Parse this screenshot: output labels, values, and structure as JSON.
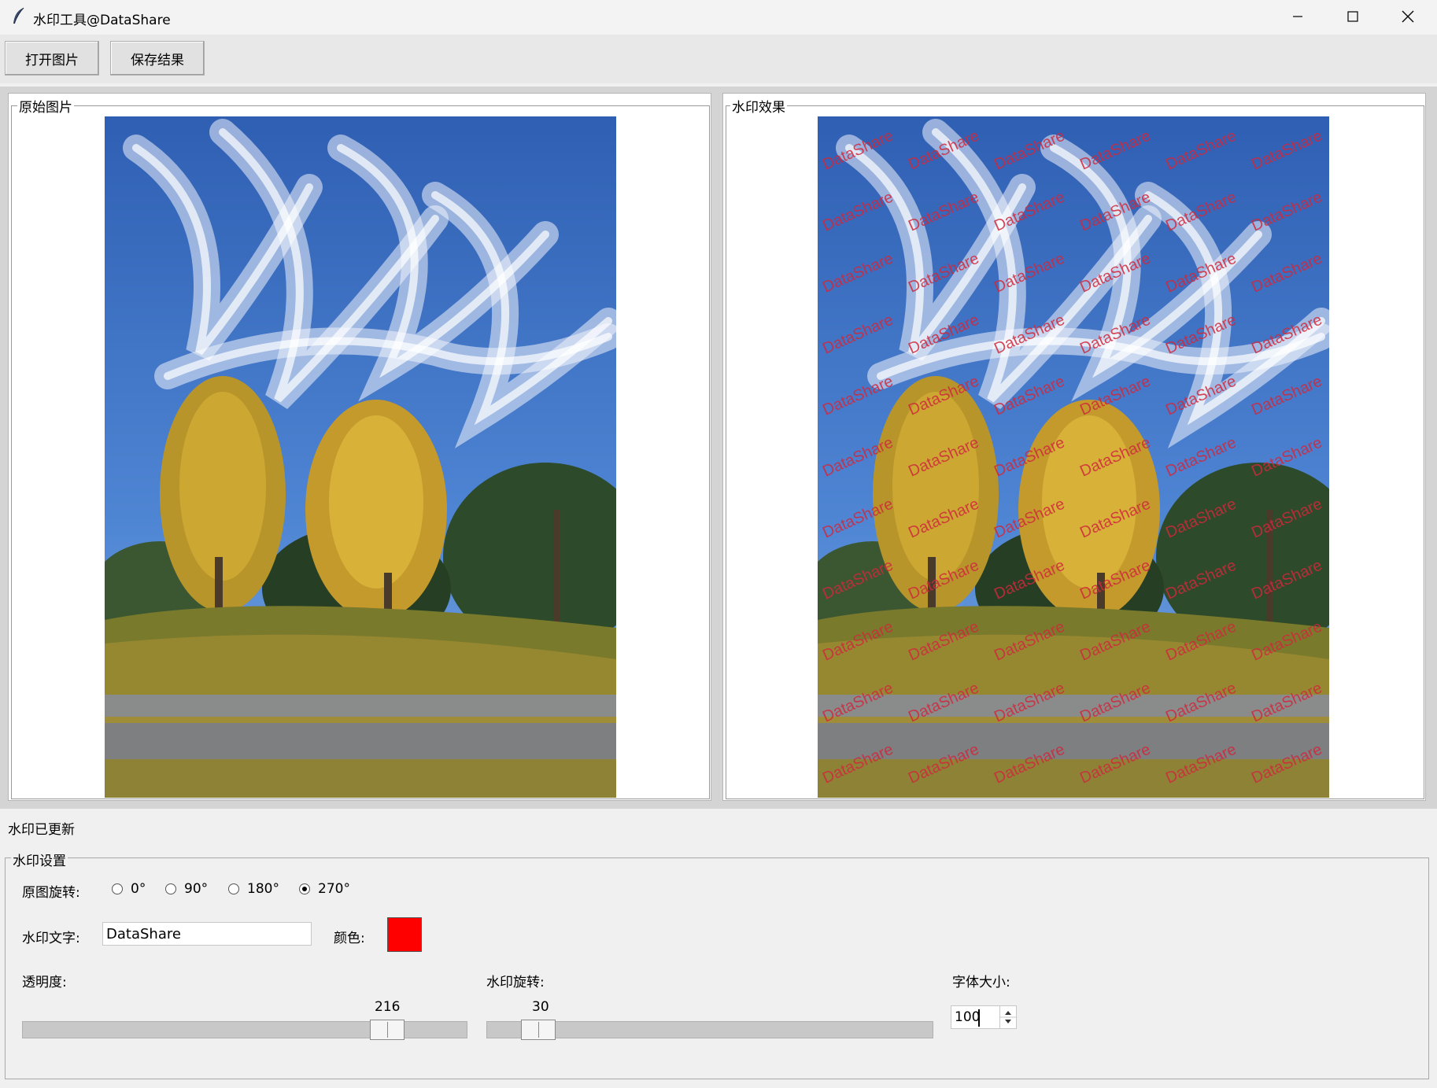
{
  "window": {
    "title": "水印工具@DataShare"
  },
  "toolbar": {
    "open_label": "打开图片",
    "save_label": "保存结果"
  },
  "panels": {
    "original_label": "原始图片",
    "result_label": "水印效果",
    "watermark_overlay_text": "DataShare",
    "watermark_overlay_color": "#d0283c"
  },
  "status": {
    "text": "水印已更新"
  },
  "settings": {
    "group_label": "水印设置",
    "rotation_label": "原图旋转:",
    "rotation_options": [
      "0°",
      "90°",
      "180°",
      "270°"
    ],
    "rotation_selected": "270°",
    "text_label": "水印文字:",
    "text_value": "DataShare",
    "color_label": "颜色:",
    "color_value": "#ff0000",
    "opacity_label": "透明度:",
    "opacity_value": "216",
    "opacity_max": 255,
    "watermark_rotation_label": "水印旋转:",
    "watermark_rotation_value": "30",
    "watermark_rotation_max": 360,
    "font_size_label": "字体大小:",
    "font_size_value": "100"
  },
  "icons": {
    "app": "feather-icon",
    "minimize": "minimize-icon",
    "maximize": "maximize-icon",
    "close": "close-icon",
    "spin_up": "spin-up-icon",
    "spin_down": "spin-down-icon"
  }
}
